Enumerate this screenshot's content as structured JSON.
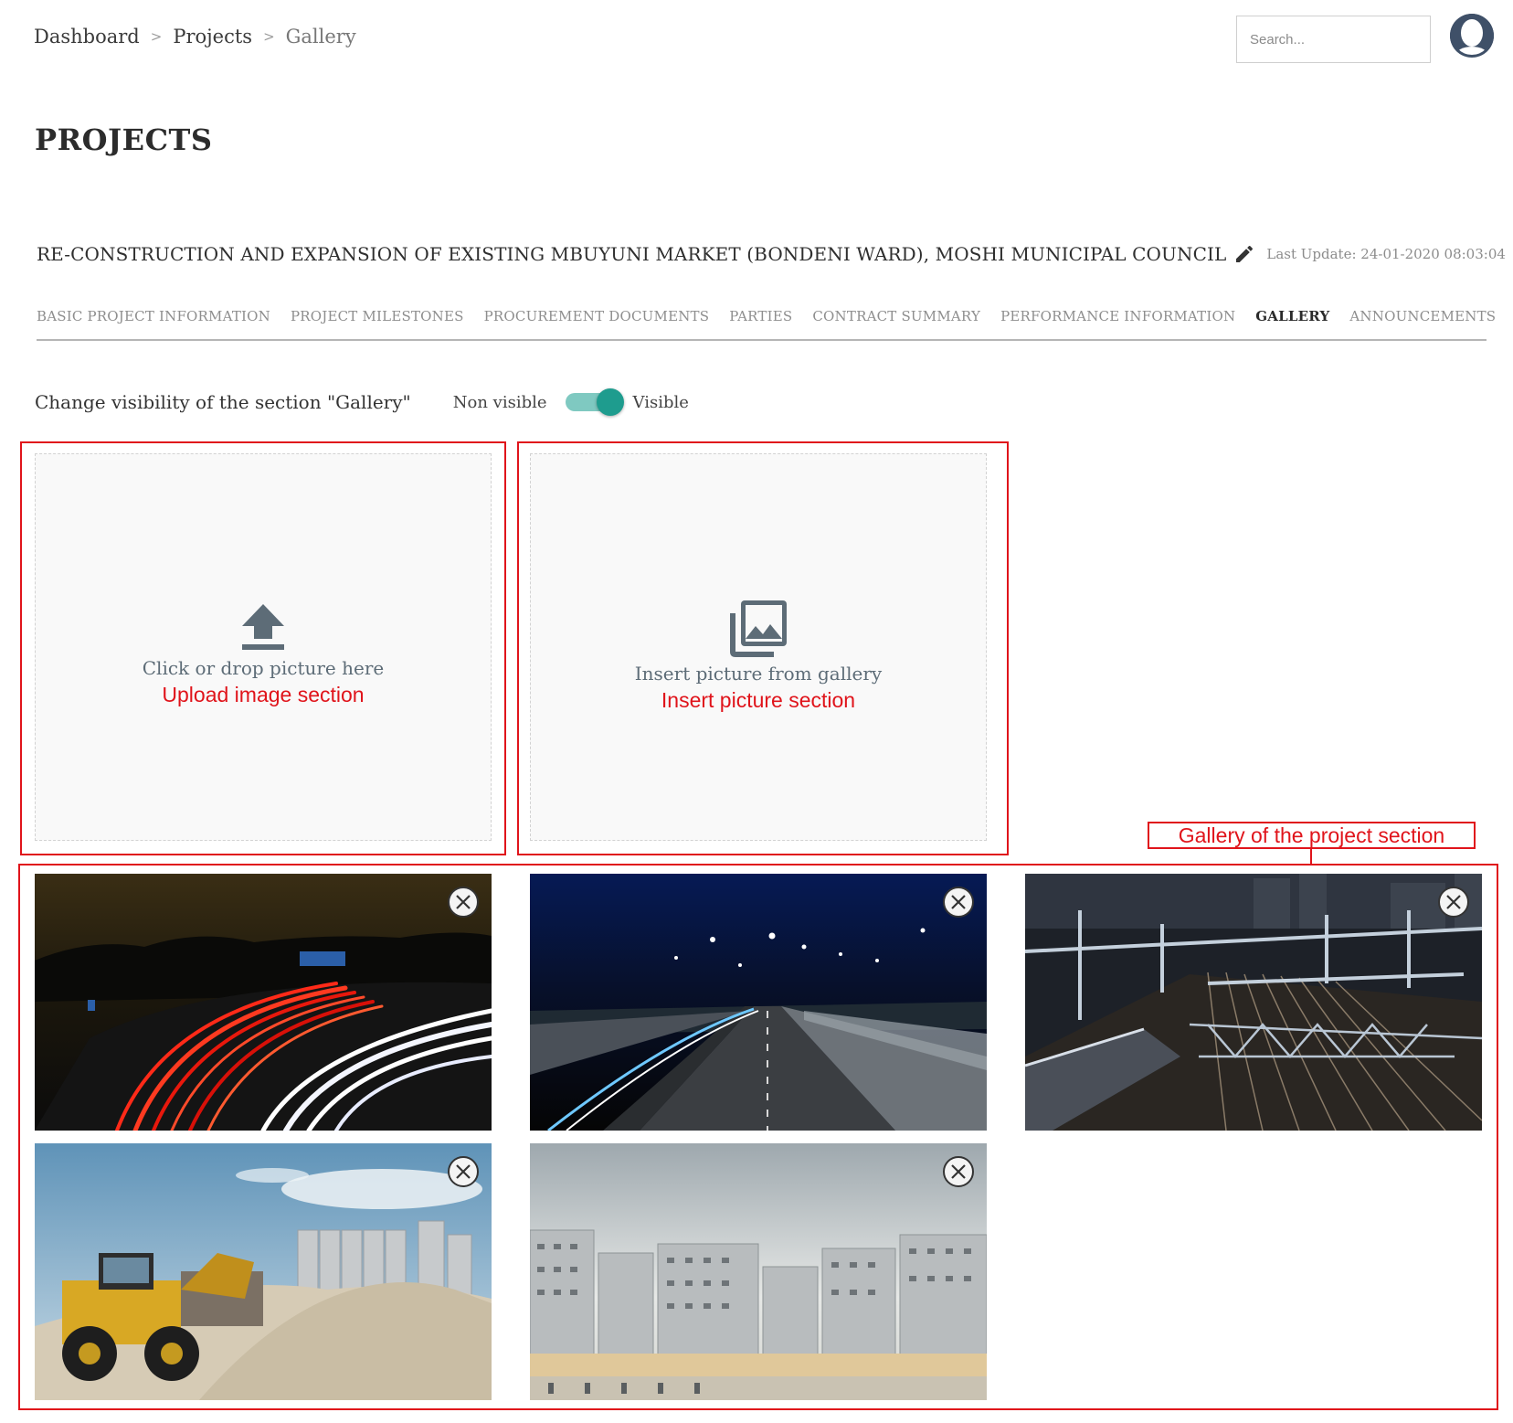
{
  "breadcrumb": {
    "items": [
      "Dashboard",
      "Projects",
      "Gallery"
    ],
    "separator": ">"
  },
  "search": {
    "placeholder": "Search..."
  },
  "page": {
    "title": "PROJECTS"
  },
  "project": {
    "title": "RE-CONSTRUCTION AND EXPANSION OF EXISTING MBUYUNI MARKET (BONDENI WARD), MOSHI MUNICIPAL COUNCIL",
    "last_update": "Last Update: 24-01-2020 08:03:04"
  },
  "tabs": [
    {
      "label": "BASIC PROJECT INFORMATION",
      "active": false
    },
    {
      "label": "PROJECT MILESTONES",
      "active": false
    },
    {
      "label": "PROCUREMENT DOCUMENTS",
      "active": false
    },
    {
      "label": "PARTIES",
      "active": false
    },
    {
      "label": "CONTRACT SUMMARY",
      "active": false
    },
    {
      "label": "PERFORMANCE INFORMATION",
      "active": false
    },
    {
      "label": "GALLERY",
      "active": true
    },
    {
      "label": "ANNOUNCEMENTS",
      "active": false
    }
  ],
  "visibility": {
    "label": "Change visibility of the section \"Gallery\"",
    "off_label": "Non visible",
    "on_label": "Visible",
    "is_visible": true
  },
  "upload": {
    "text": "Click or drop picture here",
    "annotation": "Upload image section",
    "icon": "upload-icon"
  },
  "insert": {
    "text": "Insert picture from gallery",
    "annotation": "Insert picture section",
    "icon": "photo-library-icon"
  },
  "gallery": {
    "annotation": "Gallery of the project section",
    "images": [
      {
        "name": "highway-light-trails-photo"
      },
      {
        "name": "night-overpass-photo"
      },
      {
        "name": "railway-tracks-photo"
      },
      {
        "name": "construction-loader-photo"
      },
      {
        "name": "apartment-blocks-photo"
      }
    ]
  },
  "colors": {
    "annotation": "#e0141b",
    "toggle_track": "#7fc9c1",
    "toggle_knob": "#1e9c8e",
    "icon": "#5d6c77"
  }
}
